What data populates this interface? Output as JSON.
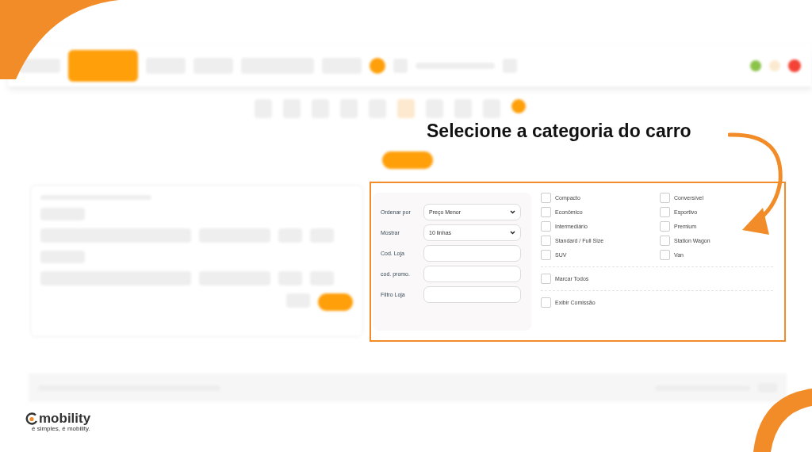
{
  "annotation": {
    "title": "Selecione a categoria do carro"
  },
  "filters": {
    "fields": [
      {
        "label": "Ordenar por",
        "kind": "select",
        "value": "Preço Menor"
      },
      {
        "label": "Mostrar",
        "kind": "select",
        "value": "10 linhas"
      },
      {
        "label": "Cod. Loja",
        "kind": "text"
      },
      {
        "label": "cod. promo.",
        "kind": "text"
      },
      {
        "label": "Filtro Loja",
        "kind": "text"
      }
    ]
  },
  "categories": [
    {
      "label": "Compacto",
      "checked": false
    },
    {
      "label": "Conversível",
      "checked": false
    },
    {
      "label": "Econômico",
      "checked": false
    },
    {
      "label": "Esportivo",
      "checked": false
    },
    {
      "label": "Intermediário",
      "checked": false
    },
    {
      "label": "Premium",
      "checked": false
    },
    {
      "label": "Standard / Full Size",
      "checked": false
    },
    {
      "label": "Station Wagon",
      "checked": false
    },
    {
      "label": "SUV",
      "checked": false
    },
    {
      "label": "Van",
      "checked": false
    }
  ],
  "select_all": {
    "label": "Marcar Todos",
    "checked": false
  },
  "show_commission": {
    "label": "Exibir Comissão",
    "checked": false
  },
  "logo": {
    "name": "mobility",
    "tagline": "é simples, é mobility."
  }
}
